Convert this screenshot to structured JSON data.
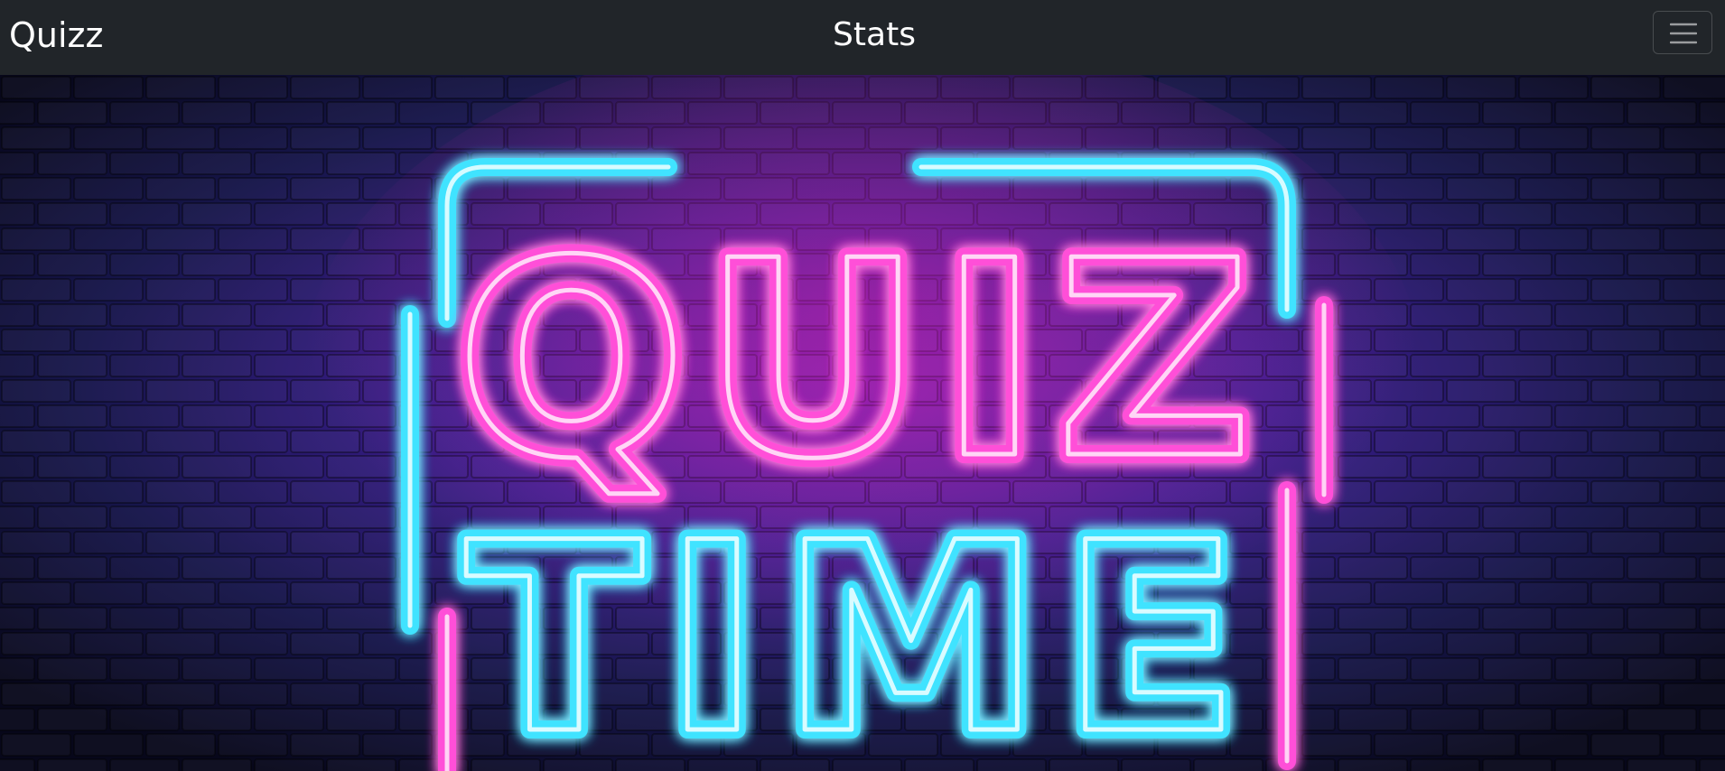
{
  "navbar": {
    "brand": "Quizz",
    "center_link": "Stats",
    "toggler_icon": "hamburger-menu-icon"
  },
  "hero": {
    "line1": "QUIZ",
    "line2": "TIME",
    "colors": {
      "wall_center": "#4a1a9a",
      "wall_edge": "#0a0a22",
      "neon_pink": "#ff4fd8",
      "neon_cyan": "#4fe8ff"
    }
  }
}
